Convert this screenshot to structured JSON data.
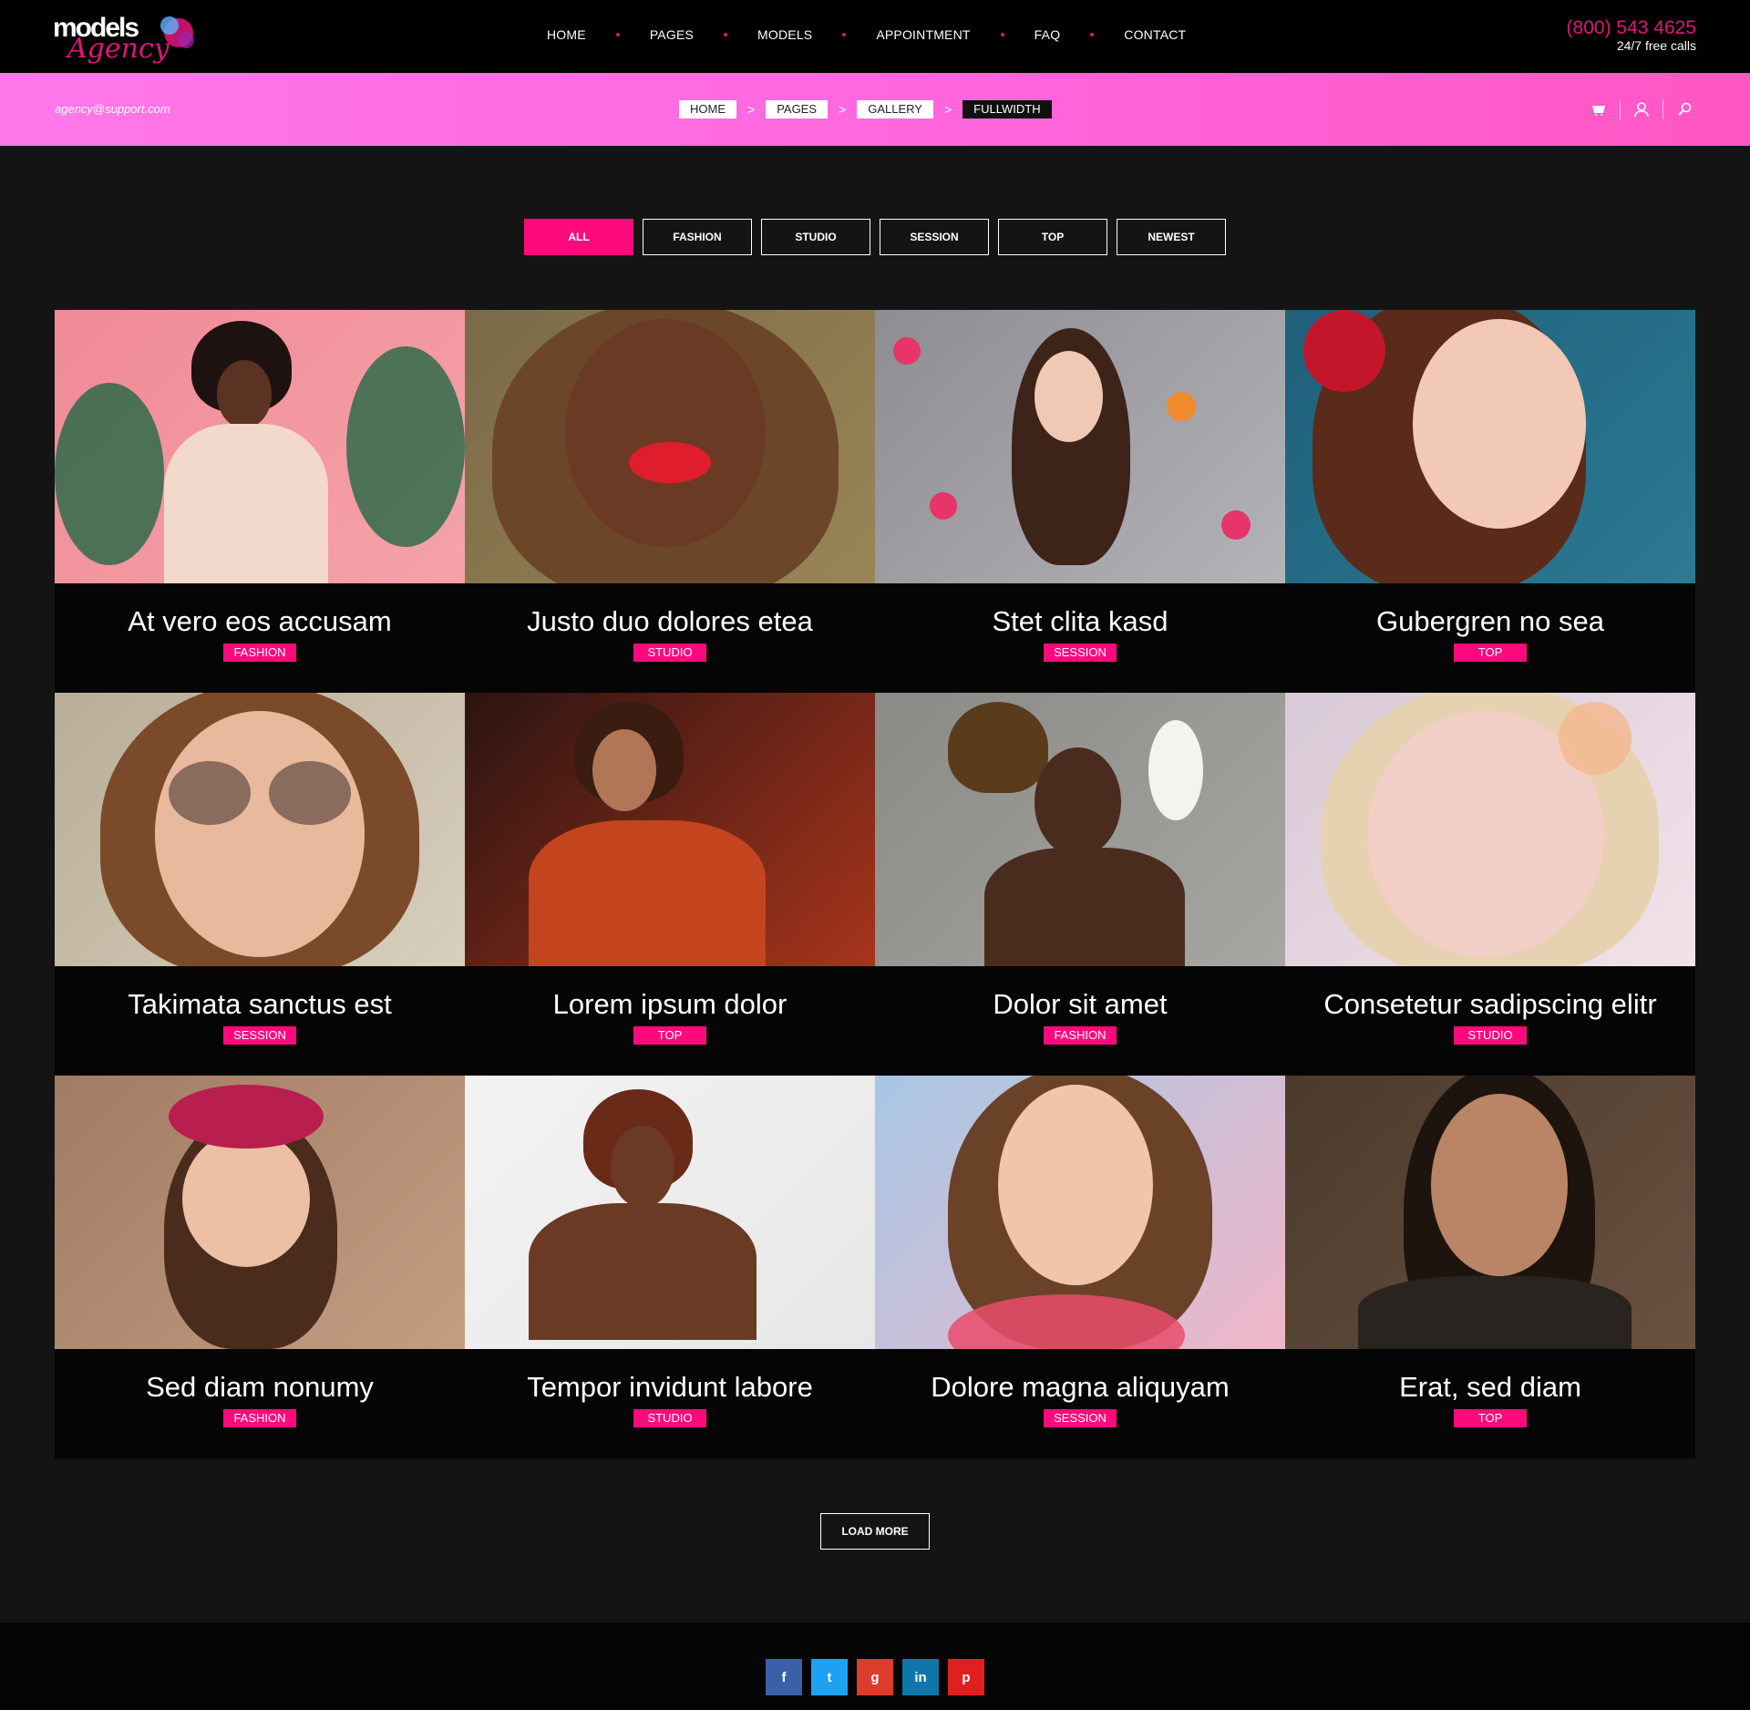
{
  "header": {
    "logo_main": "models",
    "logo_script": "Agency",
    "nav": [
      "HOME",
      "PAGES",
      "MODELS",
      "APPOINTMENT",
      "FAQ",
      "CONTACT"
    ],
    "phone": "(800) 543 4625",
    "phone_sub": "24/7 free calls"
  },
  "subbar": {
    "email": "agency@support.com",
    "breadcrumbs": [
      "HOME",
      "PAGES",
      "GALLERY",
      "FULLWIDTH"
    ],
    "separator": ">",
    "icons": [
      "cart-icon",
      "user-icon",
      "search-icon"
    ]
  },
  "filters": [
    "ALL",
    "FASHION",
    "STUDIO",
    "SESSION",
    "TOP",
    "NEWEST"
  ],
  "active_filter": "ALL",
  "gallery": [
    {
      "title": "At vero eos accusam",
      "tag": "FASHION"
    },
    {
      "title": "Justo duo dolores etea",
      "tag": "STUDIO"
    },
    {
      "title": "Stet clita kasd",
      "tag": "SESSION"
    },
    {
      "title": "Gubergren no sea",
      "tag": "TOP"
    },
    {
      "title": "Takimata sanctus est",
      "tag": "SESSION"
    },
    {
      "title": "Lorem ipsum dolor",
      "tag": "TOP"
    },
    {
      "title": "Dolor sit amet",
      "tag": "FASHION"
    },
    {
      "title": "Consetetur sadipscing elitr",
      "tag": "STUDIO"
    },
    {
      "title": "Sed diam nonumy",
      "tag": "FASHION"
    },
    {
      "title": "Tempor invidunt labore",
      "tag": "STUDIO"
    },
    {
      "title": "Dolore magna aliquyam",
      "tag": "SESSION"
    },
    {
      "title": "Erat, sed diam",
      "tag": "TOP"
    }
  ],
  "load_more": "LOAD MORE",
  "socials": [
    {
      "icon": "facebook-icon",
      "glyph": "f",
      "color": "#3b5fa8"
    },
    {
      "icon": "twitter-icon",
      "glyph": "t",
      "color": "#1da1f2"
    },
    {
      "icon": "google-plus-icon",
      "glyph": "g",
      "color": "#dd3b2b"
    },
    {
      "icon": "linkedin-icon",
      "glyph": "in",
      "color": "#0e76a8"
    },
    {
      "icon": "pinterest-icon",
      "glyph": "p",
      "color": "#e02020"
    }
  ],
  "colors": {
    "accent": "#ff0a7c",
    "subbar": "#ff66dd",
    "header": "#000000"
  }
}
